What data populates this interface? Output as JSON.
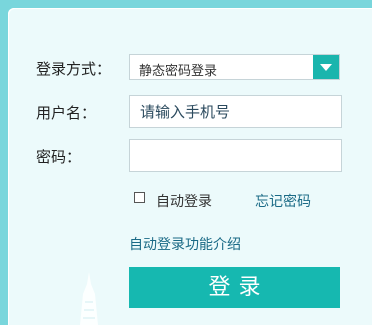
{
  "form": {
    "login_method_label": "登录方式：",
    "login_method_value": "静态密码登录",
    "username_label": "用户名：",
    "username_placeholder": "请输入手机号",
    "password_label": "密码：",
    "auto_login_label": "自动登录",
    "forgot_password_link": "忘记密码",
    "auto_login_intro_link": "自动登录功能介绍",
    "login_button": "登录"
  },
  "colors": {
    "accent": "#16b8b0",
    "page_background": "#79d6dc",
    "panel_background": "#ecfafb",
    "link": "#1a6a86"
  },
  "icons": {
    "select_arrow": "chevron-down-icon",
    "decoration": "tower-icon"
  }
}
